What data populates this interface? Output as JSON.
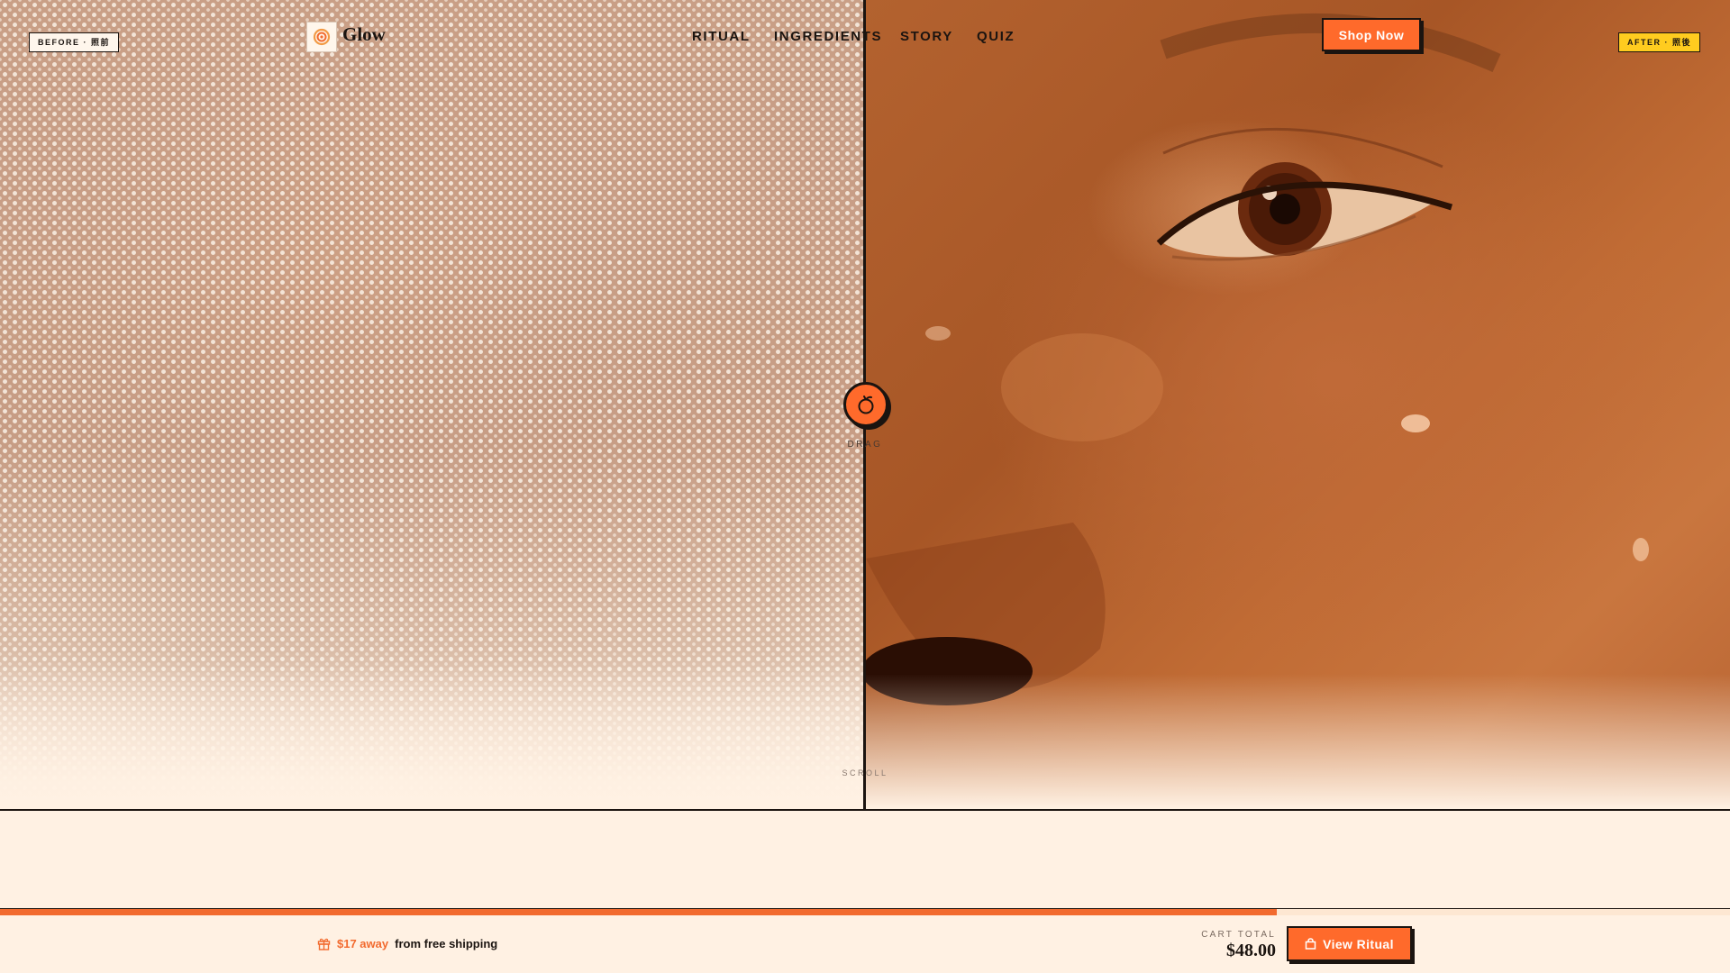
{
  "badges": {
    "before": "BEFORE · 照前",
    "after": "AFTER · 照後"
  },
  "brand": {
    "name": "Glow",
    "icon": "sun-spiral-icon",
    "accent": "#ff6a2b"
  },
  "nav": {
    "links": [
      {
        "label": "RITUAL"
      },
      {
        "label": "INGREDIENTS"
      },
      {
        "label": "STORY"
      },
      {
        "label": "QUIZ"
      }
    ],
    "cta": "Shop Now"
  },
  "compare": {
    "handle_icon": "orange-fruit-icon",
    "drag_label": "DRAG",
    "scroll_label": "SCROLL",
    "split_fraction": 0.5
  },
  "cart_bar": {
    "shipping_icon": "gift-icon",
    "shipping_amount": "$17 away",
    "shipping_text": "from free shipping",
    "progress_fraction": 0.738,
    "total_label": "CART TOTAL",
    "total_value": "$48.00",
    "view_button": "View Ritual",
    "view_icon": "bag-icon"
  }
}
